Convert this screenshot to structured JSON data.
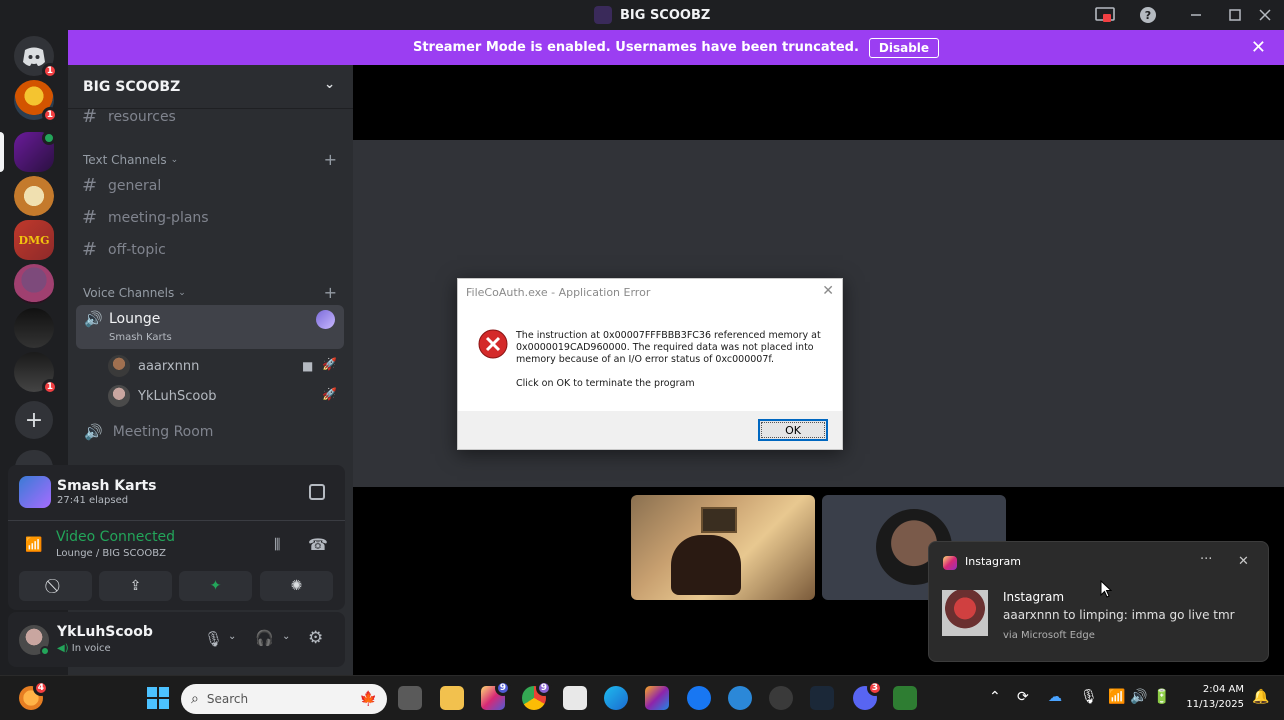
{
  "window": {
    "title": "BIG SCOOBZ",
    "controls": [
      "screen-share-icon",
      "help-icon",
      "minimize-icon",
      "maximize-icon",
      "close-icon"
    ]
  },
  "banner": {
    "message": "Streamer Mode is enabled. Usernames have been truncated.",
    "disable_label": "Disable"
  },
  "rail": {
    "badges": [
      "1",
      "1",
      "1"
    ]
  },
  "sidebar": {
    "server_name": "BIG SCOOBZ",
    "top_channel": "resources",
    "text_category": "Text Channels",
    "text_channels": [
      "general",
      "meeting-plans",
      "off-topic"
    ],
    "voice_category": "Voice Channels",
    "active_voice": {
      "name": "Lounge",
      "activity": "Smash Karts"
    },
    "voice_users": [
      "aaarxnnn",
      "YkLuhScoob"
    ],
    "other_voice": "Meeting Room"
  },
  "activity": {
    "game": "Smash Karts",
    "elapsed": "27:41 elapsed"
  },
  "rtc": {
    "status": "Video Connected",
    "location": "Lounge / BIG SCOOBZ",
    "status_color": "#23a55a"
  },
  "user": {
    "name": "YkLuhScoob",
    "status": "In voice"
  },
  "dialog": {
    "title": "FileCoAuth.exe - Application Error",
    "message": "The instruction at 0x00007FFFBBB3FC36 referenced memory at 0x0000019CAD960000. The required data was not placed into memory because of an I/O error status of 0xc000007f.",
    "hint": "Click on OK to terminate the program",
    "ok_label": "OK"
  },
  "toast": {
    "app": "Instagram",
    "title": "Instagram",
    "message": "aaarxnnn to limping: imma go live tmr",
    "source": "via Microsoft Edge"
  },
  "taskbar": {
    "search_placeholder": "Search",
    "weather_badge": "4",
    "instagram_badge": "9",
    "chrome_badge": "9",
    "discord_badge": "3",
    "time": "2:04 AM",
    "date": "11/13/2025"
  },
  "colors": {
    "brand": "#5865f2",
    "banner": "#9b3ef2",
    "danger": "#f23f42"
  }
}
